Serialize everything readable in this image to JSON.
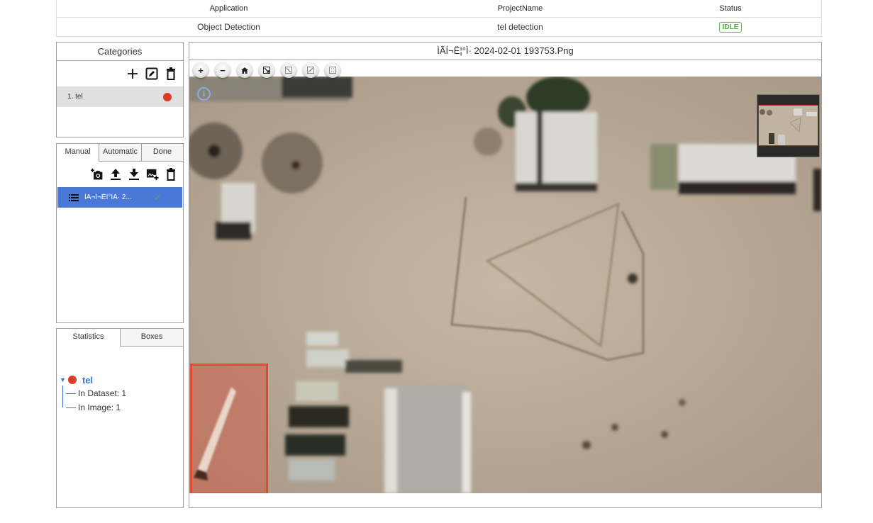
{
  "info_table": {
    "headers": [
      "Application",
      "ProjectName",
      "Status"
    ],
    "values": [
      "Object Detection",
      "tel detection",
      "IDLE"
    ],
    "status_color": "#5ea343"
  },
  "categories": {
    "title": "Categories",
    "toolbar": [
      "add-icon",
      "edit-icon",
      "delete-icon"
    ],
    "items": [
      {
        "label": "1. tel",
        "color": "#dc3b26"
      }
    ]
  },
  "image_list": {
    "tabs": [
      "Manual",
      "Automatic",
      "Done"
    ],
    "active_tab": "Manual",
    "toolbar": [
      "add-photo-icon",
      "upload-icon",
      "download-icon",
      "add-image-icon",
      "delete-icon"
    ],
    "items": [
      {
        "name": "ÌÃ¬Í­¬ËÌ°ÌÃ· 2...",
        "status": "checked"
      }
    ]
  },
  "statistics": {
    "tabs": [
      "Statistics",
      "Boxes"
    ],
    "active_tab": "Statistics",
    "tree": {
      "label": "tel",
      "color": "#dc3b26",
      "children": [
        "In Dataset: 1",
        "In Image: 1"
      ]
    }
  },
  "viewer": {
    "title": "Ì­ÃÍ­¬Ë¦°Ì­· 2024-02-01 193753.Png",
    "nav_buttons": [
      "zoom-in",
      "zoom-out",
      "home",
      "fullscreen",
      "rotate-left",
      "rotate-right",
      "flip"
    ],
    "annotations": [
      {
        "category": "tel",
        "color": "#e04a32"
      }
    ]
  },
  "glyphs": {
    "plus": "+",
    "minus": "−",
    "check": "✓",
    "caret": "▼",
    "info": "i"
  }
}
